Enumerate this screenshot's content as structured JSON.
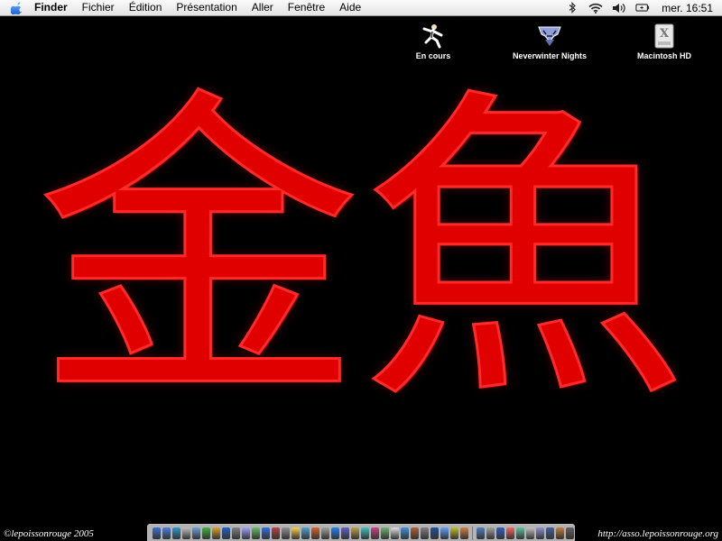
{
  "menubar": {
    "apple_icon": "apple-icon",
    "app_name": "Finder",
    "items": [
      "Fichier",
      "Édition",
      "Présentation",
      "Aller",
      "Fenêtre",
      "Aide"
    ],
    "status_icons": [
      "bluetooth-icon",
      "wifi-icon",
      "volume-icon",
      "battery-icon"
    ],
    "clock": "mer. 16:51"
  },
  "desktop": {
    "icons": [
      {
        "label": "En cours",
        "icon": "martial-arts-figure-icon"
      },
      {
        "label": "Neverwinter Nights",
        "icon": "neverwinter-logo-icon"
      },
      {
        "label": "Macintosh HD",
        "icon": "hard-drive-icon"
      }
    ]
  },
  "wallpaper": {
    "kanji": [
      "金",
      "魚"
    ],
    "color": "#e00000"
  },
  "dock": {
    "colors": [
      "#3a6fd8",
      "#4a80e0",
      "#2a9ad0",
      "#c0c0c0",
      "#6aa0e0",
      "#40b040",
      "#e0a020",
      "#2060c0",
      "#808080",
      "#a0a0ff",
      "#60c060",
      "#3070e0",
      "#c04040",
      "#909090",
      "#ffd040",
      "#50a0d0",
      "#e06020",
      "#a0a0a0",
      "#2080ff",
      "#6060c0",
      "#c0a040",
      "#40c0c0",
      "#d04080",
      "#70b070",
      "#e0e0e0",
      "#4090e0",
      "#b06030",
      "#808080",
      "#2050a0",
      "#60a0ff",
      "#c0c020",
      "#d08040",
      "#5080c0",
      "#a0a0a0",
      "#3060c0",
      "#ff6060",
      "#60c0a0",
      "#c0c0c0",
      "#9090d0",
      "#4060a0",
      "#c08040",
      "#606060"
    ]
  },
  "footer": {
    "left": "©lepoissonrouge 2005",
    "right": "http://asso.lepoissonrouge.org"
  }
}
